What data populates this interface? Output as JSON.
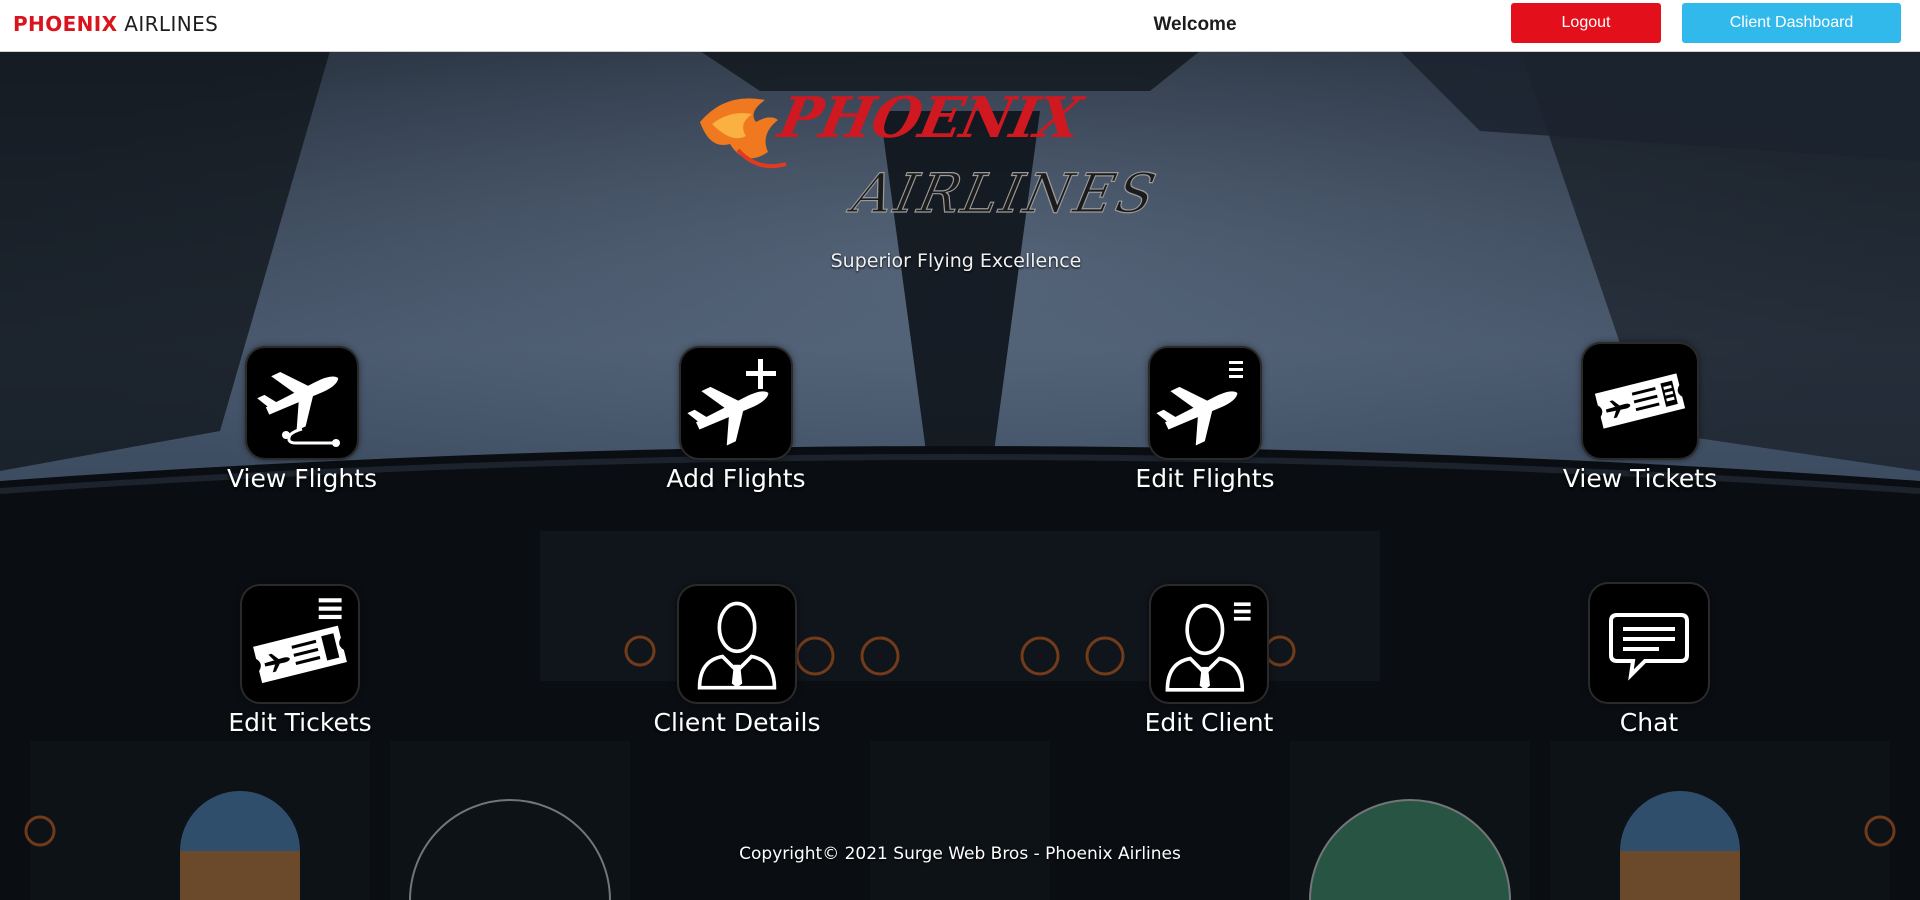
{
  "nav": {
    "brand_primary": "PHOENIX",
    "brand_secondary": "AIRLINES",
    "welcome": "Welcome",
    "logout_label": "Logout",
    "dashboard_label": "Client Dashboard"
  },
  "logo": {
    "word1": "PHOENIX",
    "word2": "AIRLINES",
    "tagline": "Superior Flying Excellence"
  },
  "tiles": [
    {
      "label": "View Flights",
      "icon": "plane-takeoff-icon"
    },
    {
      "label": "Add Flights",
      "icon": "plane-add-icon"
    },
    {
      "label": "Edit Flights",
      "icon": "plane-edit-icon"
    },
    {
      "label": "View Tickets",
      "icon": "ticket-icon"
    },
    {
      "label": "Edit Tickets",
      "icon": "ticket-edit-icon"
    },
    {
      "label": "Client Details",
      "icon": "client-icon"
    },
    {
      "label": "Edit Client",
      "icon": "client-edit-icon"
    },
    {
      "label": "Chat",
      "icon": "chat-icon"
    }
  ],
  "footer": "Copyright© 2021 Surge Web Bros - Phoenix Airlines",
  "colors": {
    "brand_red": "#d9141c",
    "logout_bg": "#e3101b",
    "dashboard_bg": "#32b9ec",
    "tile_bg": "#000000"
  }
}
